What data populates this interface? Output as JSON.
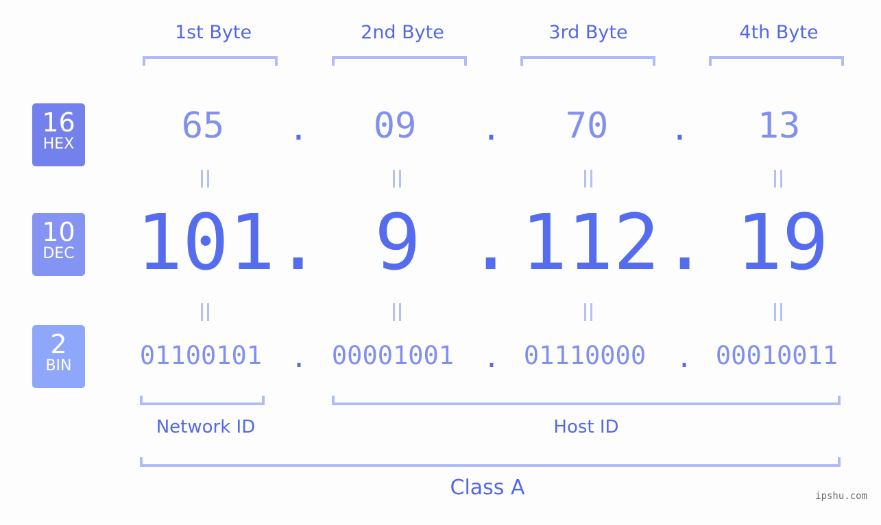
{
  "header": {
    "bytes": [
      "1st Byte",
      "2nd Byte",
      "3rd Byte",
      "4th Byte"
    ]
  },
  "badges": [
    {
      "base": "16",
      "label": "HEX",
      "color": "#7481ec"
    },
    {
      "base": "10",
      "label": "DEC",
      "color": "#8594f2"
    },
    {
      "base": "2",
      "label": "BIN",
      "color": "#8ea7fb"
    }
  ],
  "ip": {
    "hex": [
      "65",
      "09",
      "70",
      "13"
    ],
    "dec": [
      "101",
      "9",
      "112",
      "19"
    ],
    "bin": [
      "01100101",
      "00001001",
      "01110000",
      "00010011"
    ],
    "separator": "."
  },
  "segments": {
    "network_id": "Network ID",
    "host_id": "Host ID",
    "class": "Class A"
  },
  "colors": {
    "accent": "#546ced",
    "muted": "#8190ee",
    "bracket": "#b1bbf7",
    "background": "#fcfdfc"
  },
  "watermark": "ipshu.com"
}
